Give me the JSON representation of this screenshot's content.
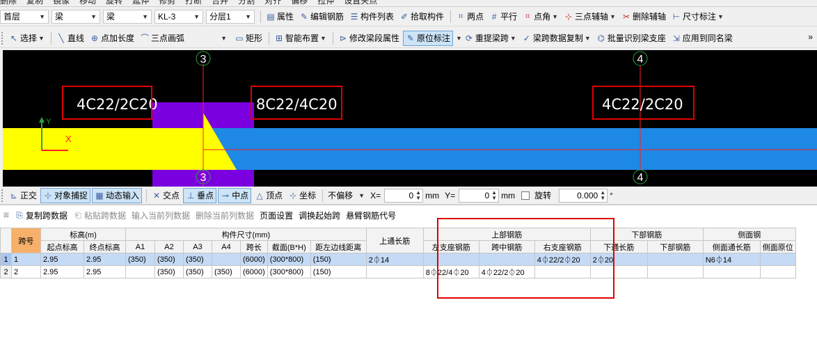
{
  "top_cut": [
    "删除",
    "复制",
    "镜像",
    "移动",
    "旋转",
    "延伸",
    "修剪",
    "打断",
    "合并",
    "分割",
    "对齐",
    "偏移",
    "拉伸",
    "设置夹点"
  ],
  "row1": {
    "floor": "首层",
    "type": "梁",
    "subtype": "梁",
    "member": "KL-3",
    "layer": "分层1",
    "buttons": [
      "属性",
      "编辑钢筋",
      "构件列表",
      "拾取构件",
      "两点",
      "平行",
      "点角",
      "三点辅轴",
      "删除辅轴",
      "尺寸标注"
    ]
  },
  "row2": {
    "select": "选择",
    "buttons": [
      "直线",
      "点加长度",
      "三点画弧"
    ],
    "buttons2": [
      "矩形",
      "智能布置",
      "修改梁段属性",
      "原位标注",
      "重提梁跨",
      "梁跨数据复制",
      "批量识别梁支座",
      "应用到同名梁"
    ],
    "active": "原位标注"
  },
  "canvas": {
    "axis_a": "3",
    "axis_b": "4",
    "label_left": "4C22/2C20",
    "label_mid": "8C22/4C20",
    "label_right": "4C22/2C20",
    "ucs_y": "Y",
    "ucs_x": "X"
  },
  "statusbar": {
    "items": [
      "正交",
      "对象捕捉",
      "动态输入",
      "交点",
      "垂点",
      "中点",
      "顶点",
      "坐标"
    ],
    "offset": "不偏移",
    "x_label": "X=",
    "x_value": "0",
    "y_label": "Y=",
    "y_value": "0",
    "unit": "mm",
    "rotate_label": "旋转",
    "rotate_value": "0.000",
    "degree": "°"
  },
  "panel_toolbar": [
    "复制跨数据",
    "粘贴跨数据",
    "输入当前列数据",
    "删除当前列数据",
    "页面设置",
    "调换起始跨",
    "悬臂钢筋代号"
  ],
  "table": {
    "group_headers": {
      "span_no": "跨号",
      "elev": "标高(m)",
      "dims": "构件尺寸(mm)",
      "top_through": "上通长筋",
      "top_rebar": "上部钢筋",
      "bot_rebar": "下部钢筋",
      "side": "侧面钢"
    },
    "sub_headers": {
      "elev": [
        "起点标高",
        "终点标高"
      ],
      "dims": [
        "A1",
        "A2",
        "A3",
        "A4",
        "跨长",
        "截面(B*H)",
        "距左边线距离"
      ],
      "top": [
        "左支座钢筋",
        "跨中钢筋",
        "右支座钢筋"
      ],
      "bot": [
        "下通长筋",
        "下部钢筋"
      ],
      "side": [
        "侧面通长筋",
        "侧面原位"
      ]
    },
    "rows": [
      [
        "1",
        "1",
        "2.95",
        "2.95",
        "(350)",
        "(350)",
        "(350)",
        "",
        "(6000)",
        "(300*800)",
        "(150)",
        "2⏀14",
        "",
        "",
        "4⏀22/2⏀20",
        "2⏀20",
        "",
        "N6⏀14",
        ""
      ],
      [
        "2",
        "2",
        "2.95",
        "2.95",
        "",
        "(350)",
        "(350)",
        "(350)",
        "(6000)",
        "(300*800)",
        "(150)",
        "",
        "8⏀22/4⏀20",
        "4⏀22/2⏀20",
        "",
        "",
        "",
        "",
        ""
      ]
    ]
  },
  "colors": {
    "canvas_bg": "#000000",
    "beam_blue": "#1e88e5",
    "yellow": "#ffff00",
    "purple": "#7b00e0",
    "axis_red": "#ff2020",
    "axis_green": "#2fa33f",
    "highlight_box": "#e00000",
    "header_orange": "#f7b06a"
  }
}
